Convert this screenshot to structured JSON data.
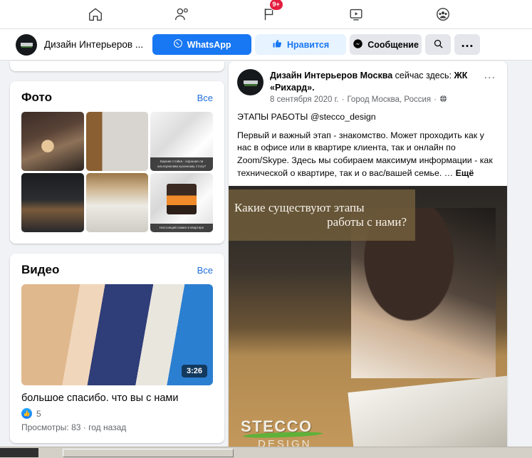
{
  "topnav": {
    "items": [
      {
        "name": "home-icon",
        "label": "Главная"
      },
      {
        "name": "friends-icon",
        "label": "Друзья"
      },
      {
        "name": "pages-icon",
        "label": "Страницы",
        "badge": "9+"
      },
      {
        "name": "watch-icon",
        "label": "Видео"
      },
      {
        "name": "groups-icon",
        "label": "Группы"
      }
    ]
  },
  "actionbar": {
    "page_name": "Дизайн Интерьеров ...",
    "whatsapp_label": "WhatsApp",
    "like_label": "Нравится",
    "message_label": "Сообщение",
    "search_label": "Поиск",
    "more_label": "..."
  },
  "sidebar": {
    "photos": {
      "title": "Фото",
      "all_label": "Все",
      "items": [
        {
          "alt": "Женщина за рабочим столом в офисе",
          "caption": ""
        },
        {
          "alt": "Три дизайнера у деревянной стены",
          "caption": ""
        },
        {
          "alt": "Барная стойка",
          "caption": "Барная стойка - хорошая ли альтернатива кухонному столу?"
        },
        {
          "alt": "Тёмный интерьер кабинета",
          "caption": ""
        },
        {
          "alt": "Светлая гостиная с деревянным потолком",
          "caption": ""
        },
        {
          "alt": "Камин в квартире",
          "caption": "Настоящий камин в квартире"
        }
      ]
    },
    "videos": {
      "title": "Видео",
      "all_label": "Все",
      "item": {
        "title": "большое спасибо. что вы с нами",
        "duration": "3:26",
        "likes": "5",
        "meta": "Просмотры: 83 · год назад",
        "alt": "Руки на синтезаторе"
      }
    }
  },
  "post": {
    "author": "Дизайн Интерьеров Москва",
    "checkin_text": "сейчас здесь:",
    "place": "ЖК «Рихард».",
    "date": "8 сентября 2020 г.",
    "location": "Город Москва, Россия",
    "privacy_icon": "globe-icon",
    "more_label": "...",
    "body_heading": "ЭТАПЫ РАБОТЫ  @stecco_design",
    "body_text": "Первый и важный этап - знакомство. Может проходить как у нас в офисе или в квартире клиента, так и онлайн по Zoom/Skype. Здесь мы собираем максимум информации - как технической о квартире, так и о вас/вашей семье. …",
    "see_more": "Ещё",
    "image": {
      "alt": "Дизайнер за ноутбуком рассматривает альбом проектов",
      "overlay_line1": "Какие существуют этапы",
      "overlay_line2": "работы с нами?",
      "watermark_top": "STECCO",
      "watermark_bottom": "DESIGN"
    }
  },
  "colors": {
    "accent": "#1877f2",
    "badge": "#e41e3f",
    "page_bg": "#f0f2f5",
    "link": "#216fdb"
  }
}
